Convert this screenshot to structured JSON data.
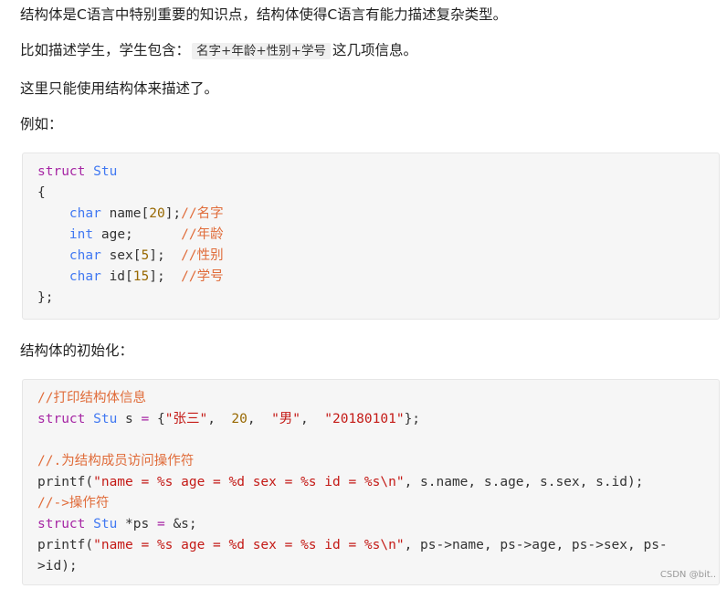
{
  "paragraphs": {
    "p1": "结构体是C语言中特别重要的知识点，结构体使得C语言有能力描述复杂类型。",
    "p2_before": "比如描述学生，学生包含：",
    "p2_code": "名字+年龄+性别+学号",
    "p2_after": "这几项信息。",
    "p3": "这里只能使用结构体来描述了。",
    "p4": "例如：",
    "p5": "结构体的初始化："
  },
  "code1": {
    "l1_kw": "struct",
    "l1_name": "Stu",
    "l2": "{",
    "l3_kw": "char",
    "l3_var": " name[",
    "l3_num": "20",
    "l3_end": "];",
    "l3_cmt": "//名字",
    "l4_kw": "int",
    "l4_var": " age;      ",
    "l4_cmt": "//年龄",
    "l5_kw": "char",
    "l5_var": " sex[",
    "l5_num": "5",
    "l5_end": "];  ",
    "l5_cmt": "//性别",
    "l6_kw": "char",
    "l6_var": " id[",
    "l6_num": "15",
    "l6_end": "];  ",
    "l6_cmt": "//学号",
    "l7": "};"
  },
  "code2": {
    "l1_cmt": "//打印结构体信息",
    "l2_kw": "struct",
    "l2_type": "Stu",
    "l2_var": " s ",
    "l2_eq": "=",
    "l2_open": " {",
    "l2_s1": "\"张三\"",
    "l2_sep1": ",  ",
    "l2_n1": "20",
    "l2_sep2": ",  ",
    "l2_s2": "\"男\"",
    "l2_sep3": ",  ",
    "l2_s3": "\"20180101\"",
    "l2_close": "};",
    "l4_cmt": "//.为结构成员访问操作符",
    "l5_fn": "printf(",
    "l5_str": "\"name = %s age = %d sex = %s id = %s\\n\"",
    "l5_args": ", s.name, s.age, s.sex, s.id);",
    "l6_cmt": "//->操作符",
    "l7_kw": "struct",
    "l7_type": "Stu",
    "l7_var": " *ps ",
    "l7_eq": "=",
    "l7_rest": " &s;",
    "l8_fn": "printf(",
    "l8_str": "\"name = %s age = %d sex = %s id = %s\\n\"",
    "l8_args": ", ps->name, ps->age, ps->sex, ps-",
    "l9": ">id);"
  },
  "watermark": "CSDN @bit.."
}
